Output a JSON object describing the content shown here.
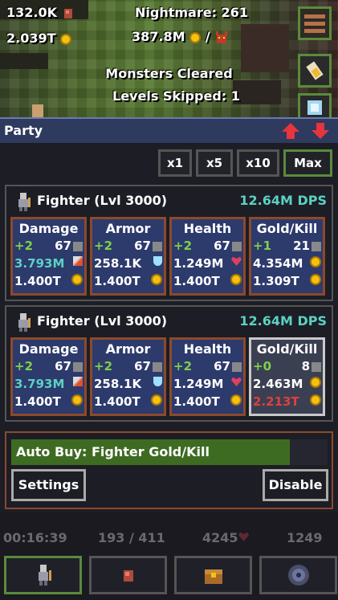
{
  "hud": {
    "gems": "132.0K",
    "gold": "2.039T",
    "nightmare": "Nightmare: 261",
    "boss_hp": "387.8M",
    "separator": "/",
    "message_line1": "Monsters Cleared",
    "message_line2": "Levels Skipped: 1"
  },
  "party": {
    "title": "Party",
    "multipliers": [
      "x1",
      "x5",
      "x10",
      "Max"
    ],
    "selected_multiplier": "Max",
    "heroes": [
      {
        "name": "Fighter (Lvl 3000)",
        "dps": "12.64M DPS",
        "stats": [
          {
            "title": "Damage",
            "plus": "+2",
            "level": "67",
            "value": "3.793M",
            "cost": "1.400T"
          },
          {
            "title": "Armor",
            "plus": "+2",
            "level": "67",
            "value": "258.1K",
            "cost": "1.400T"
          },
          {
            "title": "Health",
            "plus": "+2",
            "level": "67",
            "value": "1.249M",
            "cost": "1.400T"
          },
          {
            "title": "Gold/Kill",
            "plus": "+1",
            "level": "21",
            "value": "4.354M",
            "cost": "1.309T"
          }
        ]
      },
      {
        "name": "Fighter (Lvl 3000)",
        "dps": "12.64M DPS",
        "stats": [
          {
            "title": "Damage",
            "plus": "+2",
            "level": "67",
            "value": "3.793M",
            "cost": "1.400T"
          },
          {
            "title": "Armor",
            "plus": "+2",
            "level": "67",
            "value": "258.1K",
            "cost": "1.400T"
          },
          {
            "title": "Health",
            "plus": "+2",
            "level": "67",
            "value": "1.249M",
            "cost": "1.400T"
          },
          {
            "title": "Gold/Kill",
            "plus": "+0",
            "level": "8",
            "value": "2.463M",
            "cost": "2.213T"
          }
        ]
      }
    ]
  },
  "autobuy": {
    "label": "Auto Buy: Fighter Gold/Kill",
    "progress": 0.88,
    "settings_label": "Settings",
    "disable_label": "Disable"
  },
  "status": {
    "time": "00:16:39",
    "progress": "193 / 411",
    "health": "4245",
    "attack": "1249"
  },
  "nav": [
    "party-tab",
    "items-tab",
    "chest-tab",
    "portal-tab"
  ],
  "colors": {
    "dps": "#5bd1c2",
    "plus": "#7fd04a",
    "value_teal": "#5bd1c2",
    "unaffordable": "#e0403c",
    "autobuy_bar": "#3e6b22"
  }
}
